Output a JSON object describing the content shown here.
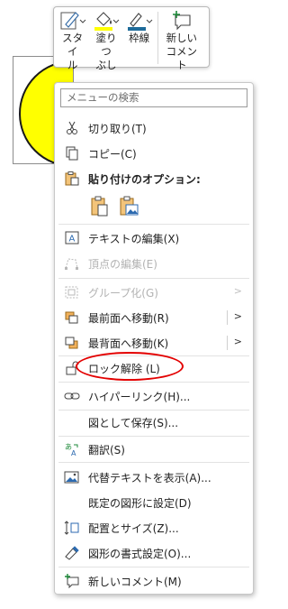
{
  "toolbar": {
    "style_label_1": "スタイ",
    "style_label_2": "ル",
    "fill_label_1": "塗りつ",
    "fill_label_2": "ぶし",
    "outline_label": "枠線",
    "comment_label_1": "新しい",
    "comment_label_2": "コメント",
    "fill_color": "#ffff00",
    "outline_color": "#1e6b9a"
  },
  "shape": {
    "fill_color": "#ffff00"
  },
  "menu": {
    "search_placeholder": "メニューの検索",
    "items": [
      {
        "label": "切り取り(T)",
        "icon": "scissors-icon",
        "enabled": true
      },
      {
        "label": "コピー(C)",
        "icon": "copy-icon",
        "enabled": true
      },
      {
        "label": "貼り付けのオプション:",
        "icon": "paste-icon",
        "enabled": true
      },
      {
        "label": "テキストの編集(X)",
        "icon": "text-edit-icon",
        "enabled": true
      },
      {
        "label": "頂点の編集(E)",
        "icon": "edit-points-icon",
        "enabled": false
      },
      {
        "label": "グループ化(G)",
        "icon": "group-icon",
        "enabled": false
      },
      {
        "label": "最前面へ移動(R)",
        "icon": "bring-front-icon",
        "enabled": true
      },
      {
        "label": "最背面へ移動(K)",
        "icon": "send-back-icon",
        "enabled": true
      },
      {
        "label": "ロック解除 (L)",
        "icon": "unlock-icon",
        "enabled": true
      },
      {
        "label": "ハイパーリンク(H)...",
        "icon": "link-icon",
        "enabled": true
      },
      {
        "label": "図として保存(S)...",
        "icon": "",
        "enabled": true
      },
      {
        "label": "翻訳(S)",
        "icon": "translate-icon",
        "enabled": true
      },
      {
        "label": "代替テキストを表示(A)...",
        "icon": "alt-text-icon",
        "enabled": true
      },
      {
        "label": "既定の図形に設定(D)",
        "icon": "",
        "enabled": true
      },
      {
        "label": "配置とサイズ(Z)...",
        "icon": "size-position-icon",
        "enabled": true
      },
      {
        "label": "図形の書式設定(O)...",
        "icon": "format-shape-icon",
        "enabled": true
      },
      {
        "label": "新しいコメント(M)",
        "icon": "new-comment-icon",
        "enabled": true
      }
    ]
  },
  "highlight_color": "#e30000"
}
